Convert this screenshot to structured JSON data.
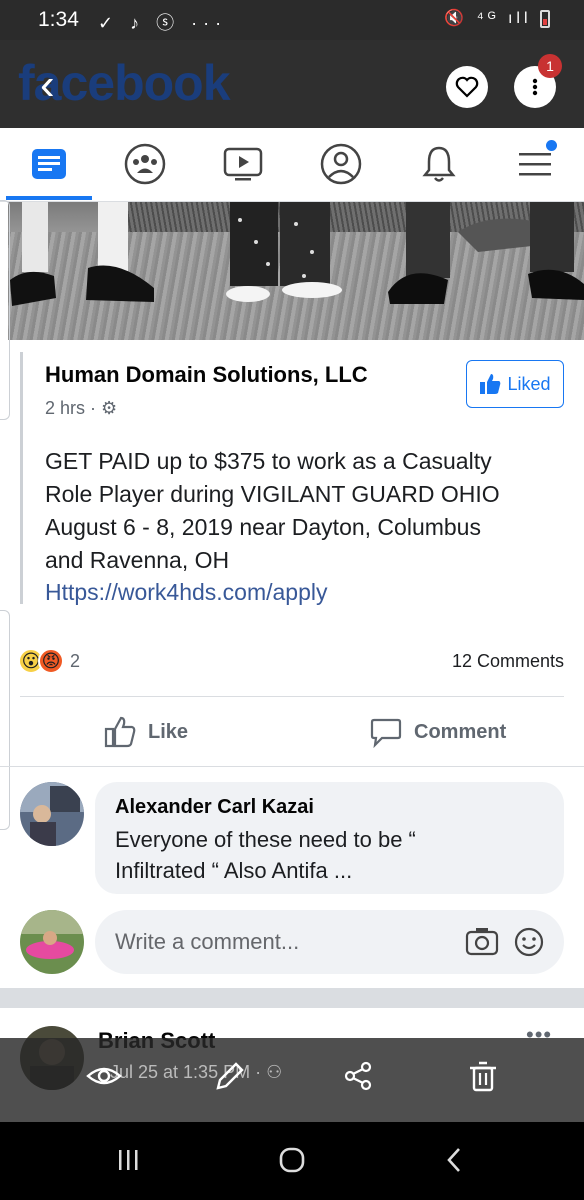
{
  "status_bar": {
    "time": "1:34",
    "left_icons": "✓ ♪ ⓢ ···",
    "right_icons": "🔇 ⁴ᴳ ıll"
  },
  "header": {
    "logo_text": "facebook",
    "badge_count": "1"
  },
  "nav": {
    "tabs": [
      "news-feed",
      "groups",
      "watch",
      "profile",
      "notifications",
      "menu"
    ]
  },
  "post": {
    "page_name": "Human Domain Solutions, LLC",
    "time": "2 hrs",
    "liked_label": "Liked",
    "text": "GET PAID up to $375 to work as a Casualty\nRole Player during VIGILANT GUARD OHIO\nAugust 6 - 8, 2019 near Dayton, Columbus\nand Ravenna, OH",
    "link": "Https://work4hds.com/apply",
    "reaction_count": "2",
    "comments_count": "12 Comments",
    "like_label": "Like",
    "comment_label": "Comment"
  },
  "comment": {
    "author": "Alexander Carl Kazai",
    "text": "Everyone of these need to be “\nInfiltrated “ Also Antifa  ..."
  },
  "composer": {
    "placeholder": "Write a comment..."
  },
  "next_post": {
    "author": "Brian Scott",
    "meta": "Jul 25 at 1:35 PM",
    "more": "•••"
  },
  "colors": {
    "accent": "#1877f2",
    "link": "#385898",
    "header_bg": "#2f2f2f"
  }
}
